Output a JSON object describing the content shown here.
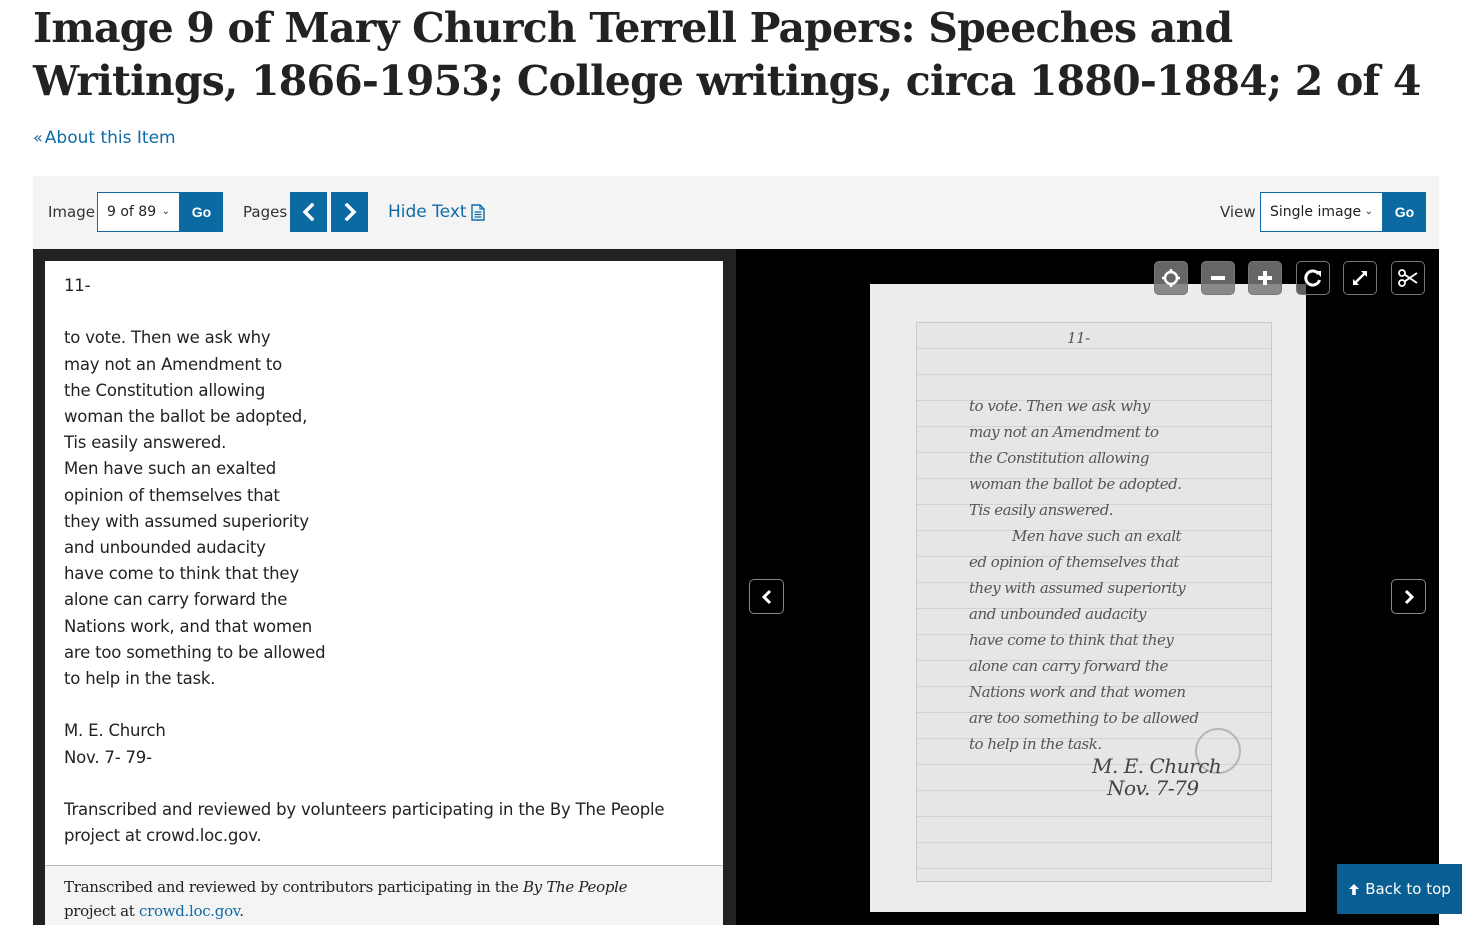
{
  "page": {
    "title": "Image 9 of Mary Church Terrell Papers: Speeches and Writings, 1866-1953; College writings, circa 1880-1884; 2 of 4",
    "about_link": "About this Item"
  },
  "toolbar": {
    "image_label": "Image",
    "image_select_value": "9 of 89",
    "image_go": "Go",
    "pages_label": "Pages",
    "hide_text": "Hide Text",
    "view_label": "View",
    "view_select_value": "Single image",
    "view_go": "Go"
  },
  "transcript": {
    "lines": [
      "11-",
      "",
      "to vote. Then we ask why",
      "may not an Amendment to",
      "the Constitution allowing",
      "woman the ballot be adopted,",
      "Tis easily answered.",
      "Men have such an exalted",
      "opinion of themselves that",
      "they with assumed superiority",
      "and unbounded audacity",
      "have come to think that they",
      "alone can carry forward the",
      "Nations work, and that women",
      "are too something to be allowed",
      "to help in the task.",
      "",
      "M. E. Church",
      "Nov. 7- 79-",
      "",
      "Transcribed and reviewed by volunteers participating in the By The People",
      "project at crowd.loc.gov."
    ],
    "credit_prefix": "Transcribed and reviewed by contributors participating in the ",
    "credit_project": "By The People",
    "credit_mid": "project at ",
    "credit_link": "crowd.loc.gov",
    "credit_suffix": "."
  },
  "viewer": {
    "controls": [
      "home-icon",
      "zoom-out-icon",
      "zoom-in-icon",
      "rotate-icon",
      "fullscreen-icon",
      "crop-scissors-icon"
    ],
    "handwriting": [
      "11-",
      "to vote.   Then we ask why",
      "may not an Amendment to",
      "the Constitution allowing",
      "woman the ballot be adopted.",
      "Tis easily answered.",
      "Men have such an exalt",
      "ed opinion of themselves that",
      "they with assumed superiority",
      "and unbounded audacity",
      "have come to think that they",
      "alone can carry forward the",
      "Nations work and that women",
      "are too something to be allowed",
      "to help in the task.",
      "M. E. Church",
      "Nov. 7-79"
    ]
  },
  "back_to_top": "Back to top",
  "colors": {
    "accent": "#0a6aa1",
    "link": "#0f6aa8",
    "toolbar_bg": "#f4f4f4",
    "viewer_bg": "#000000",
    "pane_bg": "#222222"
  }
}
